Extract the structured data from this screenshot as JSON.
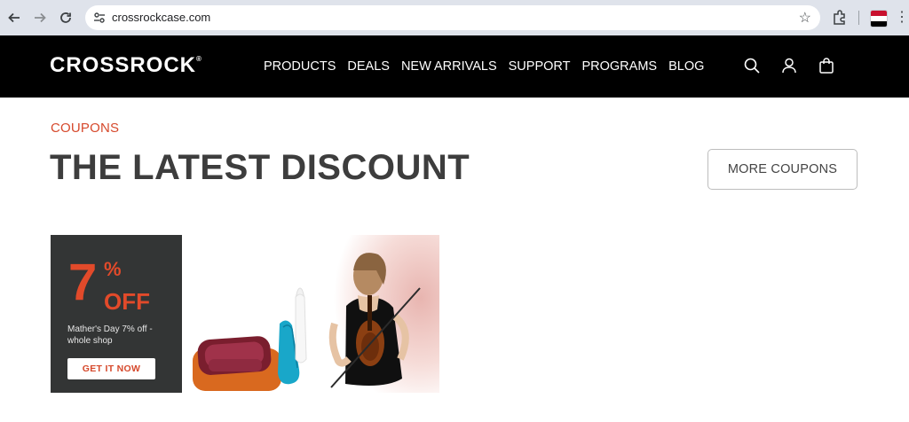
{
  "browser": {
    "url": "crossrockcase.com",
    "icons": [
      "back-arrow-icon",
      "forward-arrow-icon",
      "reload-icon",
      "site-settings-icon",
      "bookmark-star-icon",
      "extensions-icon",
      "profile-flag-icon",
      "menu-dots-icon"
    ]
  },
  "header": {
    "logo": "CROSSROCK",
    "logo_mark": "®",
    "nav": [
      "PRODUCTS",
      "DEALS",
      "NEW ARRIVALS",
      "SUPPORT",
      "PROGRAMS",
      "BLOG"
    ],
    "icons": [
      "search-icon",
      "account-icon",
      "cart-icon"
    ]
  },
  "main": {
    "eyebrow": "COUPONS",
    "title": "THE LATEST DISCOUNT",
    "more_button": "MORE COUPONS"
  },
  "coupon": {
    "percent": "7",
    "percent_sign": "%",
    "off": "OFF",
    "description": "Mather's Day 7% off - whole shop",
    "cta": "GET IT NOW"
  },
  "colors": {
    "accent": "#d6492c",
    "header_bg": "#000000",
    "card_bg": "#333535",
    "title": "#3d3d3d"
  }
}
